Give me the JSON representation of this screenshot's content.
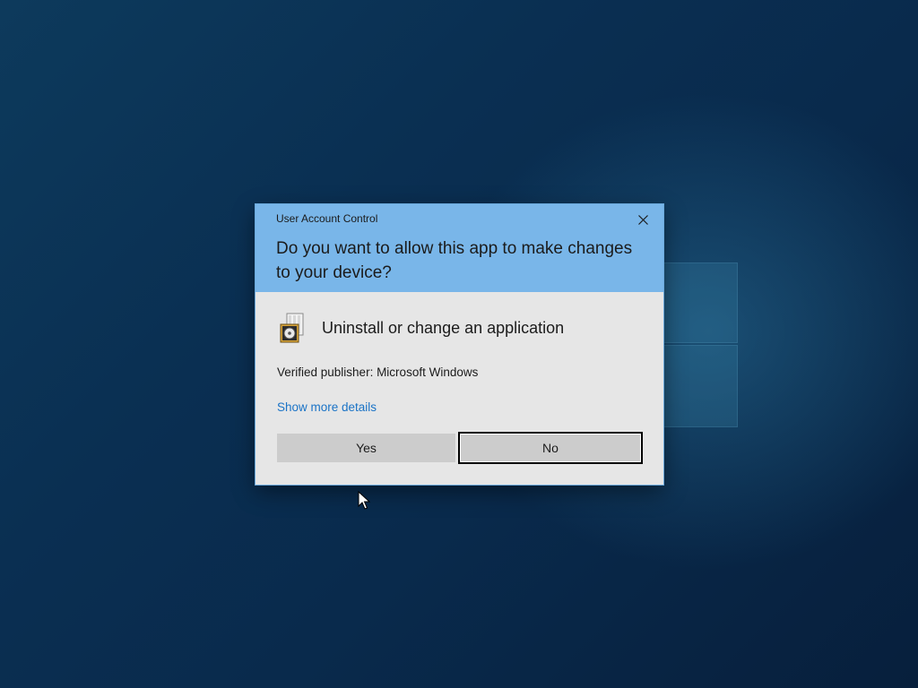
{
  "dialog": {
    "title": "User Account Control",
    "question": "Do you want to allow this app to make changes to your device?",
    "app_name": "Uninstall or change an application",
    "publisher": "Verified publisher: Microsoft Windows",
    "details_link": "Show more details",
    "yes_label": "Yes",
    "no_label": "No",
    "header_color": "#79b6e9",
    "body_color": "#e6e6e6",
    "link_color": "#1a73c6"
  },
  "icons": {
    "close": "close-icon",
    "app": "programs-and-features-icon",
    "pointer": "mouse-pointer-icon"
  }
}
